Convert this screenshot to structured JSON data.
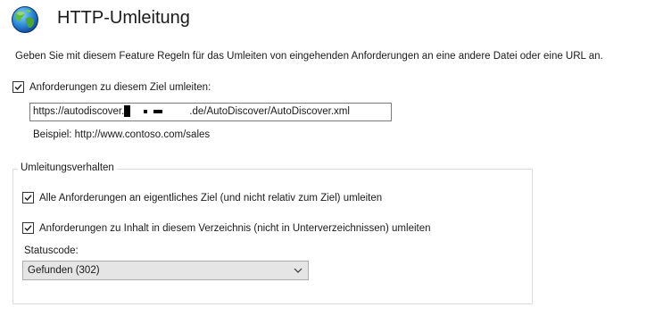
{
  "header": {
    "title": "HTTP-Umleitung",
    "icon": "globe-icon"
  },
  "description": "Geben Sie mit diesem Feature Regeln für das Umleiten von eingehenden Anforderungen an eine andere Datei oder eine URL an.",
  "redirect": {
    "enabled": true,
    "checkbox_label": "Anforderungen zu diesem Ziel umleiten:",
    "url_prefix": "https://autodiscover.",
    "url_suffix": ".de/AutoDiscover/AutoDiscover.xml",
    "example": "Beispiel: http://www.contoso.com/sales"
  },
  "behavior": {
    "legend": "Umleitungsverhalten",
    "exact_destination": {
      "checked": true,
      "label": "Alle Anforderungen an eigentliches Ziel (und nicht relativ zum Ziel) umleiten"
    },
    "this_directory_only": {
      "checked": true,
      "label": "Anforderungen zu Inhalt in diesem Verzeichnis (nicht in Unterverzeichnissen) umleiten"
    },
    "status_label": "Statuscode:",
    "status_value": "Gefunden (302)"
  },
  "colors": {
    "select_background": "#e5e5e5",
    "border": "#7a7a7a",
    "group_border": "#dcdcdc"
  }
}
